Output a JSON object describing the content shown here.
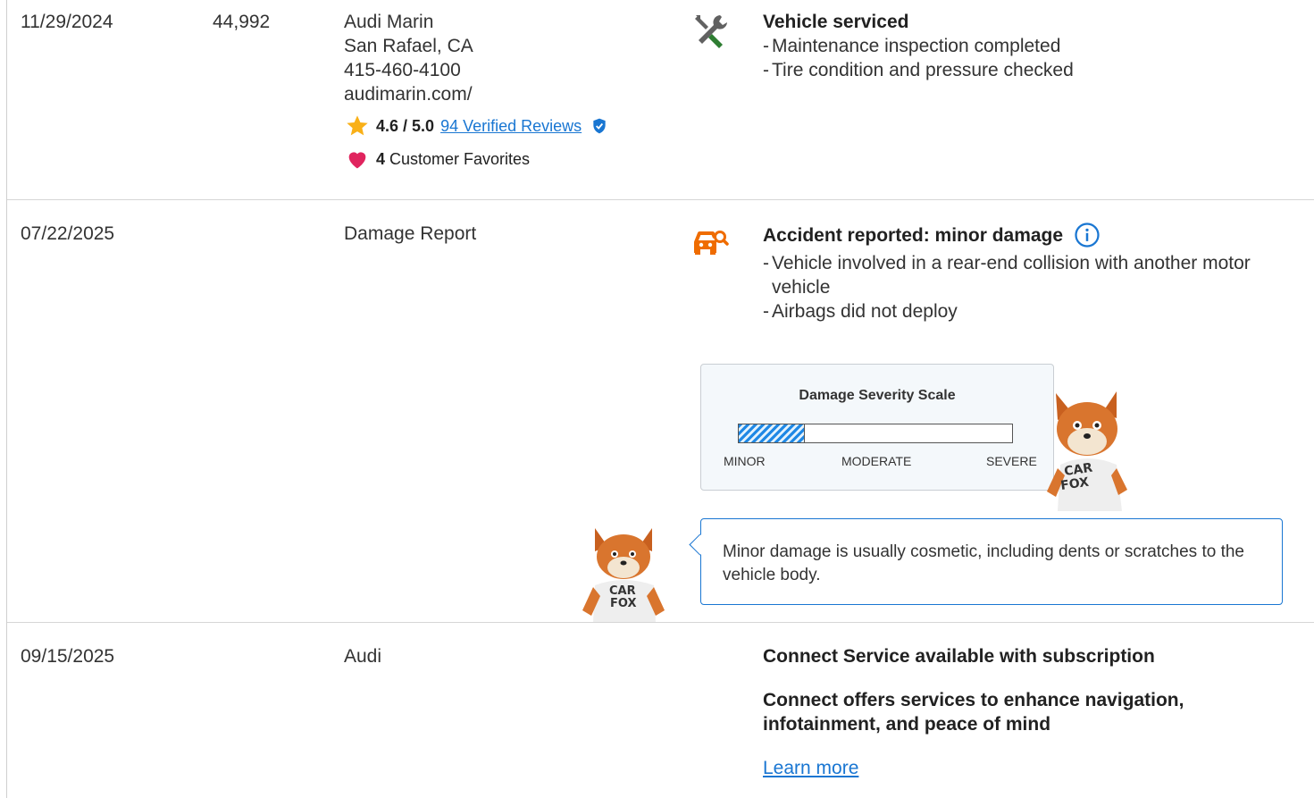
{
  "records": [
    {
      "date": "11/29/2024",
      "odometer": "44,992",
      "source": {
        "name": "Audi Marin",
        "location": "San Rafael, CA",
        "phone": "415-460-4100",
        "website": "audimarin.com/",
        "rating": "4.6 / 5.0",
        "reviews_link": "94 Verified Reviews",
        "favorites_count": "4",
        "favorites_label": "Customer Favorites"
      },
      "icon": "service-tools-icon",
      "title": "Vehicle serviced",
      "details": [
        "Maintenance inspection completed",
        "Tire condition and pressure checked"
      ]
    },
    {
      "date": "07/22/2025",
      "source": {
        "name": "Damage Report"
      },
      "icon": "accident-car-icon",
      "title": "Accident reported: minor damage",
      "details": [
        "Vehicle involved in a rear-end collision with another motor vehicle",
        "Airbags did not deploy"
      ],
      "severity": {
        "title": "Damage Severity Scale",
        "level": 0.24,
        "labels": [
          "MINOR",
          "MODERATE",
          "SEVERE"
        ]
      },
      "tooltip": "Minor damage is usually cosmetic, including dents or scratches to the vehicle body.",
      "mascot_shirt": "CAR FOX"
    },
    {
      "date": "09/15/2025",
      "source": {
        "name": "Audi"
      },
      "title": "Connect Service available with subscription",
      "subtitle": "Connect offers services to enhance navigation, infotainment, and peace of mind",
      "link": "Learn more"
    }
  ],
  "colors": {
    "link": "#1976d2",
    "star": "#f9b017",
    "heart": "#e0245e",
    "tools_handle": "#2e7d32",
    "accident": "#ef6c00",
    "info": "#1976d2"
  }
}
